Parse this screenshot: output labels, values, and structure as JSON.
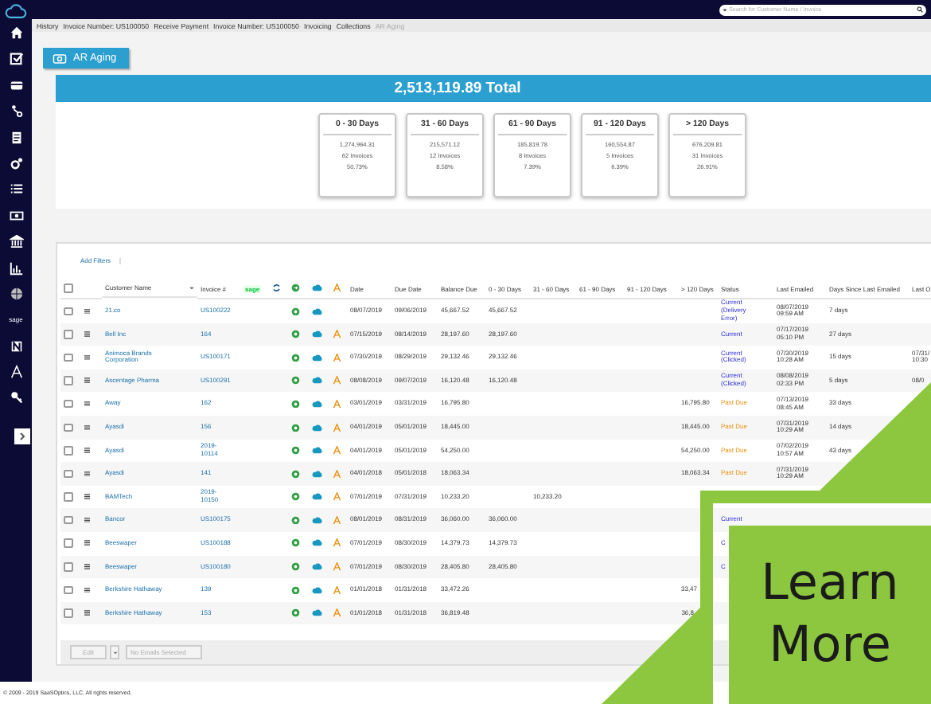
{
  "top_bar": {
    "search": {
      "placeholder": "Search for Customer Name / Invoice"
    }
  },
  "sidebar": {
    "brand_label": "sage"
  },
  "breadcrumb": [
    {
      "label": "History",
      "selected": false
    },
    {
      "label": "Invoice Number: US100050",
      "selected": false
    },
    {
      "label": "Receive Payment",
      "selected": false
    },
    {
      "label": "Invoice Number: US100050",
      "selected": false
    },
    {
      "label": "Invoicing",
      "selected": false
    },
    {
      "label": "Collections",
      "selected": false
    },
    {
      "label": "AR Aging",
      "selected": true
    }
  ],
  "page_tab": {
    "label": "AR Aging"
  },
  "total": "2,513,119.89 Total",
  "buckets": [
    {
      "label": "0 - 30 Days",
      "amount": "1,274,964.31",
      "invoices": "62 Invoices",
      "percent": "50.73%"
    },
    {
      "label": "31 - 60 Days",
      "amount": "215,571.12",
      "invoices": "12 Invoices",
      "percent": "8.58%"
    },
    {
      "label": "61 - 90 Days",
      "amount": "185,819.78",
      "invoices": "8 Invoices",
      "percent": "7.39%"
    },
    {
      "label": "91 - 120 Days",
      "amount": "160,554.87",
      "invoices": "5 Invoices",
      "percent": "6.39%"
    },
    {
      "label": "> 120 Days",
      "amount": "676,209.81",
      "invoices": "31 Invoices",
      "percent": "26.91%"
    }
  ],
  "filters_button": "Add Filters",
  "table": {
    "columns": [
      "Customer Name",
      "Invoice #",
      "sage",
      "Date",
      "Due Date",
      "Balance Due",
      "0 - 30 Days",
      "31 - 60 Days",
      "61 - 90 Days",
      "91 - 120 Days",
      "> 120 Days",
      "Status",
      "Last Emailed",
      "Days Since Last Emailed",
      "Last O"
    ],
    "header_checked": false,
    "rows": [
      {
        "checked": false,
        "customer": "21.co",
        "invoice": "US100222",
        "a_icon": false,
        "date": "08/07/2019",
        "due_date": "09/06/2019",
        "balance_due": "45,667.52",
        "days_0_30": "45,667.52",
        "status": "Current (Delivery Error)",
        "overdue": false,
        "last_emailed": "08/07/2019 09:59 AM",
        "days_since": "7 days"
      },
      {
        "checked": false,
        "customer": "Bell Inc",
        "invoice": "164",
        "a_icon": true,
        "date": "07/15/2019",
        "due_date": "08/14/2019",
        "balance_due": "28,197.60",
        "days_0_30": "28,197.60",
        "status": "Current",
        "overdue": false,
        "last_emailed": "07/17/2019 05:10 PM",
        "days_since": "27 days"
      },
      {
        "checked": false,
        "customer": "Animoca Brands Corporation",
        "invoice": "US100171",
        "a_icon": true,
        "date": "07/30/2019",
        "due_date": "08/29/2019",
        "balance_due": "29,132.46",
        "days_0_30": "29,132.46",
        "status": "Current (Clicked)",
        "overdue": false,
        "last_emailed": "07/30/2019 10:28 AM",
        "days_since": "15 days",
        "last_o": "07/31/ 10:30"
      },
      {
        "checked": false,
        "customer": "Ascentage Pharma",
        "invoice": "US100291",
        "a_icon": true,
        "date": "08/08/2019",
        "due_date": "09/07/2019",
        "balance_due": "16,120.48",
        "days_0_30": "16,120.48",
        "status": "Current (Clicked)",
        "overdue": false,
        "last_emailed": "08/08/2019 02:33 PM",
        "days_since": "5 days",
        "last_o": "08/0"
      },
      {
        "checked": false,
        "customer": "Away",
        "invoice": "162",
        "a_icon": true,
        "date": "03/01/2019",
        "due_date": "03/31/2019",
        "balance_due": "16,795.80",
        "days_over_120": "16,795.80",
        "status": "Past Due",
        "overdue": true,
        "last_emailed": "07/13/2019 08:45 AM",
        "days_since": "33 days"
      },
      {
        "checked": false,
        "customer": "Ayasdi",
        "invoice": "156",
        "a_icon": true,
        "date": "04/01/2019",
        "due_date": "05/01/2019",
        "balance_due": "18,445.00",
        "days_over_120": "18,445.00",
        "status": "Past Due",
        "overdue": true,
        "last_emailed": "07/31/2019 10:29 AM",
        "days_since": "14 days"
      },
      {
        "checked": false,
        "customer": "Ayasdi",
        "invoice": "2019-10114",
        "a_icon": true,
        "date": "04/01/2019",
        "due_date": "05/01/2019",
        "balance_due": "54,250.00",
        "days_over_120": "54,250.00",
        "status": "Past Due",
        "overdue": true,
        "last_emailed": "07/02/2019 10:57 AM",
        "days_since": "43 days"
      },
      {
        "checked": false,
        "customer": "Ayasdi",
        "invoice": "141",
        "a_icon": true,
        "date": "04/01/2018",
        "due_date": "05/01/2018",
        "balance_due": "18,063.34",
        "days_over_120": "18,063.34",
        "status": "Past Due",
        "overdue": true,
        "last_emailed": "07/31/2019 10:29 AM"
      },
      {
        "checked": false,
        "customer": "BAMTech",
        "invoice": "2019-10150",
        "a_icon": true,
        "date": "07/01/2019",
        "due_date": "07/31/2019",
        "balance_due": "10,233.20",
        "days_31_60": "10,233.20"
      },
      {
        "checked": false,
        "customer": "Bancor",
        "invoice": "US100175",
        "a_icon": true,
        "date": "08/01/2019",
        "due_date": "08/31/2019",
        "balance_due": "36,060.00",
        "days_0_30": "36,060.00",
        "status": "Current",
        "overdue": false
      },
      {
        "checked": false,
        "customer": "Beeswaper",
        "invoice": "US100188",
        "a_icon": true,
        "date": "07/01/2019",
        "due_date": "08/30/2019",
        "balance_due": "14,379.73",
        "days_0_30": "14,379.73",
        "status": "C",
        "overdue": false
      },
      {
        "checked": false,
        "customer": "Beeswaper",
        "invoice": "US100180",
        "a_icon": true,
        "date": "07/01/2019",
        "due_date": "08/30/2019",
        "balance_due": "28,405.80",
        "days_0_30": "28,405.80",
        "status": "C",
        "overdue": false
      },
      {
        "checked": false,
        "customer": "Berkshire Hathaway",
        "invoice": "139",
        "a_icon": true,
        "date": "01/01/2018",
        "due_date": "01/31/2018",
        "balance_due": "33,472.26",
        "days_over_120": "33,47"
      },
      {
        "checked": false,
        "customer": "Berkshire Hathaway",
        "invoice": "153",
        "a_icon": true,
        "date": "01/01/2018",
        "due_date": "01/31/2018",
        "balance_due": "36,819.48",
        "days_over_120": "36,8"
      }
    ]
  },
  "table_footer": {
    "edit_button": {
      "label": "Edit",
      "disabled": true
    },
    "email_field": {
      "placeholder": "No Emails Selected"
    }
  },
  "promo": {
    "label": "Learn More"
  },
  "copyright": "© 2009 - 2019 SaaSOptics, LLC. All rights reserved."
}
